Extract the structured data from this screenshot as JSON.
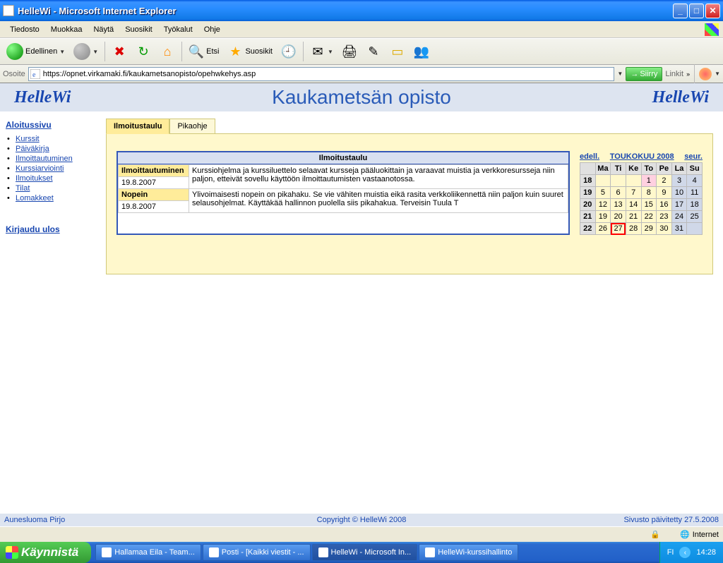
{
  "window": {
    "title": "HelleWi - Microsoft Internet Explorer"
  },
  "menu": {
    "items": [
      "Tiedosto",
      "Muokkaa",
      "Näytä",
      "Suosikit",
      "Työkalut",
      "Ohje"
    ]
  },
  "toolbar": {
    "back": "Edellinen",
    "search": "Etsi",
    "favorites": "Suosikit"
  },
  "address": {
    "label": "Osoite",
    "url": "https://opnet.virkamaki.fi/kaukametsanopisto/opehwkehys.asp",
    "go": "Siirry",
    "links": "Linkit"
  },
  "brand": "HelleWi",
  "page_title": "Kaukametsän opisto",
  "sidebar": {
    "head": "Aloitussivu",
    "items": [
      "Kurssit",
      "Päiväkirja",
      "Ilmoittautuminen",
      "Kurssiarviointi",
      "Ilmoitukset",
      "Tilat",
      "Lomakkeet"
    ],
    "signout": "Kirjaudu ulos"
  },
  "tabs": {
    "t0": "Ilmoitustaulu",
    "t1": "Pikaohje"
  },
  "announce": {
    "title": "Ilmoitustaulu",
    "r0": {
      "head": "Ilmoittautuminen",
      "date": "19.8.2007",
      "text": "Kurssiohjelma ja kurssiluettelo selaavat kursseja pääluokittain ja varaavat muistia ja verkkoresursseja niin paljon, etteivät sovellu käyttöön ilmoittautumisten vastaanotossa."
    },
    "r1": {
      "head": "Nopein",
      "date": "19.8.2007",
      "text": "Ylivoimaisesti nopein on pikahaku. Se vie vähiten muistia eikä rasita verkkoliikennettä niin paljon kuin suuret selausohjelmat. Käyttäkää hallinnon puolella siis pikahakua. Terveisin Tuula T"
    }
  },
  "cal": {
    "prev": "edell.",
    "title": "TOUKOKUU  2008",
    "next": "seur.",
    "dow": [
      "",
      "Ma",
      "Ti",
      "Ke",
      "To",
      "Pe",
      "La",
      "Su"
    ],
    "rows": [
      [
        "18",
        "",
        "",
        "",
        "1",
        "2",
        "3",
        "4"
      ],
      [
        "19",
        "5",
        "6",
        "7",
        "8",
        "9",
        "10",
        "11"
      ],
      [
        "20",
        "12",
        "13",
        "14",
        "15",
        "16",
        "17",
        "18"
      ],
      [
        "21",
        "19",
        "20",
        "21",
        "22",
        "23",
        "24",
        "25"
      ],
      [
        "22",
        "26",
        "27",
        "28",
        "29",
        "30",
        "31",
        ""
      ]
    ]
  },
  "footer": {
    "left": "Aunesluoma Pirjo",
    "mid": "Copyright © HelleWi 2008",
    "right": "Sivusto päivitetty 27.5.2008"
  },
  "status": {
    "zone": "Internet"
  },
  "taskbar": {
    "start": "Käynnistä",
    "tasks": [
      "Hallamaa Eila - Team...",
      "Posti - [Kaikki viestit - ...",
      "HelleWi - Microsoft In...",
      "HelleWi-kurssihallinto"
    ],
    "lang": "FI",
    "time": "14:28"
  }
}
